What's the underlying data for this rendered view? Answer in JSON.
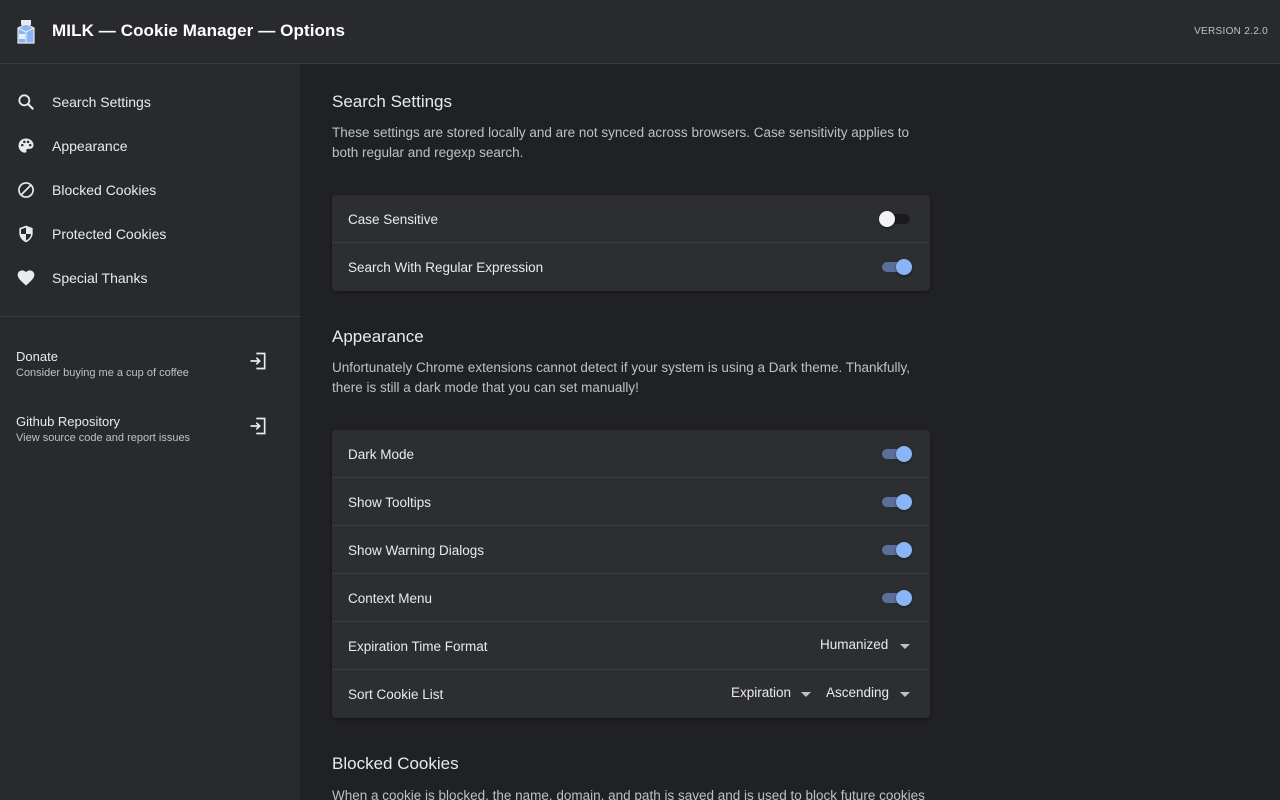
{
  "header": {
    "title": "MILK — Cookie Manager — Options",
    "version": "VERSION 2.2.0",
    "logo_icon": "milk-carton-icon"
  },
  "sidebar": {
    "items": [
      {
        "label": "Search Settings",
        "icon": "search-icon"
      },
      {
        "label": "Appearance",
        "icon": "palette-icon"
      },
      {
        "label": "Blocked Cookies",
        "icon": "block-icon"
      },
      {
        "label": "Protected Cookies",
        "icon": "shield-icon"
      },
      {
        "label": "Special Thanks",
        "icon": "heart-icon"
      }
    ],
    "links": [
      {
        "title": "Donate",
        "subtitle": "Consider buying me a cup of coffee",
        "icon": "open-in-icon"
      },
      {
        "title": "Github Repository",
        "subtitle": "View source code and report issues",
        "icon": "open-in-icon"
      }
    ]
  },
  "sections": {
    "search": {
      "title": "Search Settings",
      "description": "These settings are stored locally and are not synced across browsers. Case sensitivity applies to both regular and regexp search.",
      "rows": [
        {
          "label": "Case Sensitive",
          "on": false
        },
        {
          "label": "Search With Regular Expression",
          "on": true
        }
      ]
    },
    "appearance": {
      "title": "Appearance",
      "description": "Unfortunately Chrome extensions cannot detect if your system is using a Dark theme. Thankfully, there is still a dark mode that you can set manually!",
      "rows": [
        {
          "label": "Dark Mode",
          "on": true
        },
        {
          "label": "Show Tooltips",
          "on": true
        },
        {
          "label": "Show Warning Dialogs",
          "on": true
        },
        {
          "label": "Context Menu",
          "on": true
        }
      ],
      "expiration": {
        "label": "Expiration Time Format",
        "value": "Humanized"
      },
      "sort": {
        "label": "Sort Cookie List",
        "field": "Expiration",
        "order": "Ascending"
      }
    },
    "blocked": {
      "title": "Blocked Cookies",
      "description": "When a cookie is blocked, the name, domain, and path is saved and is used to block future cookies"
    }
  },
  "colors": {
    "accent": "#8ab4f8",
    "background": "#202124",
    "surface": "#292a2d",
    "card": "#2d2e31"
  }
}
